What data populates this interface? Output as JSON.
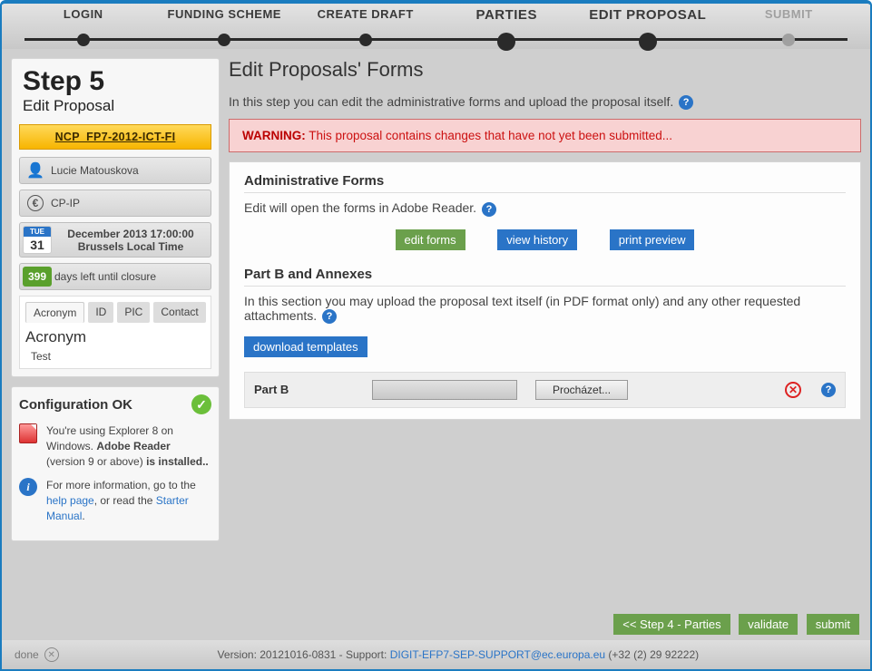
{
  "steps": [
    "LOGIN",
    "FUNDING SCHEME",
    "CREATE DRAFT",
    "PARTIES",
    "EDIT PROPOSAL",
    "SUBMIT"
  ],
  "sidebar": {
    "step_title": "Step 5",
    "step_sub": "Edit Proposal",
    "project_code": "NCP_FP7-2012-ICT-FI",
    "user": "Lucie Matouskova",
    "scheme": "CP-IP",
    "dow": "TUE",
    "day": "31",
    "deadline_line1": "December 2013 17:00:00",
    "deadline_line2": "Brussels Local Time",
    "days_left": "399",
    "days_label": "days left until closure",
    "tabs": [
      "Acronym",
      "ID",
      "PIC",
      "Contact"
    ],
    "tab_heading": "Acronym",
    "tab_value": "Test"
  },
  "config": {
    "title": "Configuration OK",
    "br1": "You're using Explorer 8 on Windows.",
    "br2": "Adobe Reader",
    "br3": "(version 9 or above)",
    "br4": "is installed..",
    "h1": "For more information, go to the",
    "help_link": "help page",
    "h2": ", or read the",
    "manual_link": "Starter Manual",
    "h3": "."
  },
  "main": {
    "title": "Edit Proposals' Forms",
    "intro": "In this step you can edit the administrative forms and upload the proposal itself.",
    "warn_label": "WARNING:",
    "warn_text": "This proposal contains changes that have not yet been submitted...",
    "af_title": "Administrative Forms",
    "af_desc": "Edit will open the forms in Adobe Reader.",
    "btn_edit": "edit forms",
    "btn_history": "view history",
    "btn_print": "print preview",
    "pb_title": "Part B and Annexes",
    "pb_desc": "In this section you may upload the proposal text itself (in PDF format only) and any other requested attachments.",
    "btn_download": "download templates",
    "partb_label": "Part B",
    "browse": "Procházet..."
  },
  "footer": {
    "back": "<< Step 4 - Parties",
    "validate": "validate",
    "submit": "submit",
    "done": "done",
    "version_pre": "Version: 20121016-0831 - Support: ",
    "email": "DIGIT-EFP7-SEP-SUPPORT@ec.europa.eu",
    "phone": " (+32 (2) 29 92222)"
  }
}
